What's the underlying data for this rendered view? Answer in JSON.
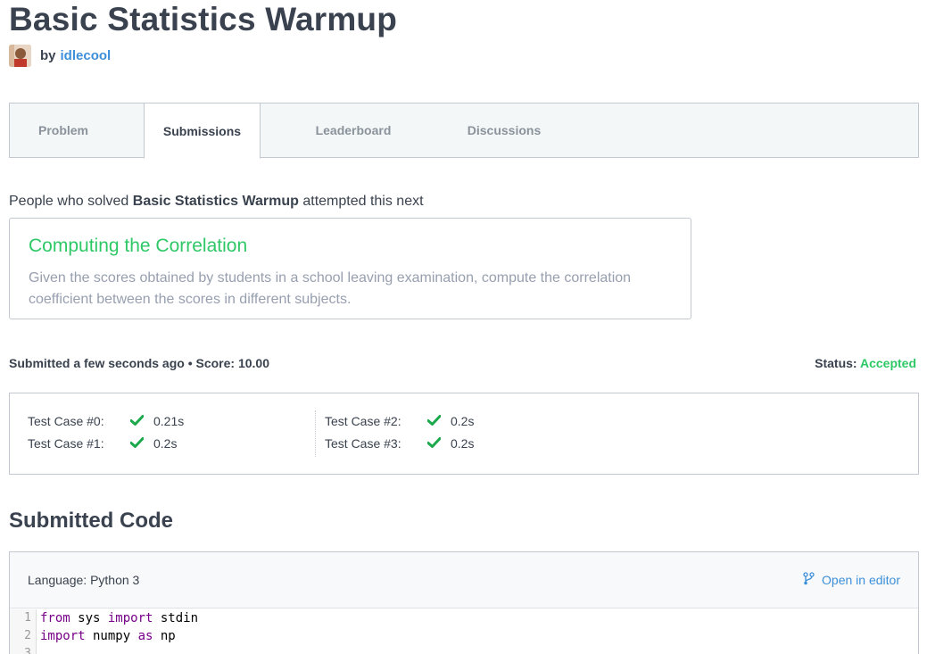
{
  "page": {
    "title": "Basic Statistics Warmup",
    "by_label": "by",
    "author": "idlecool"
  },
  "tabs": [
    {
      "label": "Problem",
      "active": false
    },
    {
      "label": "Submissions",
      "active": true
    },
    {
      "label": "Leaderboard",
      "active": false
    },
    {
      "label": "Discussions",
      "active": false
    }
  ],
  "recommendation": {
    "prefix": "People who solved",
    "problem": "Basic Statistics Warmup",
    "suffix": "attempted this next",
    "title": "Computing the Correlation",
    "description": "Given the scores obtained by students in a school leaving examination, compute the correlation coefficient between the scores in different subjects."
  },
  "submission": {
    "meta": "Submitted a few seconds ago • Score: 10.00",
    "status_label": "Status:",
    "status_value": "Accepted"
  },
  "test_cases": [
    {
      "label": "Test Case #0:",
      "time": "0.21s"
    },
    {
      "label": "Test Case #1:",
      "time": "0.2s"
    },
    {
      "label": "Test Case #2:",
      "time": "0.2s"
    },
    {
      "label": "Test Case #3:",
      "time": "0.2s"
    }
  ],
  "code": {
    "heading": "Submitted Code",
    "language": "Language: Python 3",
    "open_editor": "Open in editor",
    "lines": [
      {
        "num": "1",
        "kw1": "from",
        "t1": " sys ",
        "kw2": "import",
        "t2": " stdin"
      },
      {
        "num": "2",
        "kw1": "import",
        "t1": " numpy ",
        "kw2": "as",
        "t2": " np"
      },
      {
        "num": "3",
        "kw1": "",
        "t1": "",
        "kw2": "",
        "t2": ""
      }
    ]
  },
  "colors": {
    "accent_green": "#2ec866",
    "link_blue": "#3d8fd9",
    "text": "#39424e"
  }
}
